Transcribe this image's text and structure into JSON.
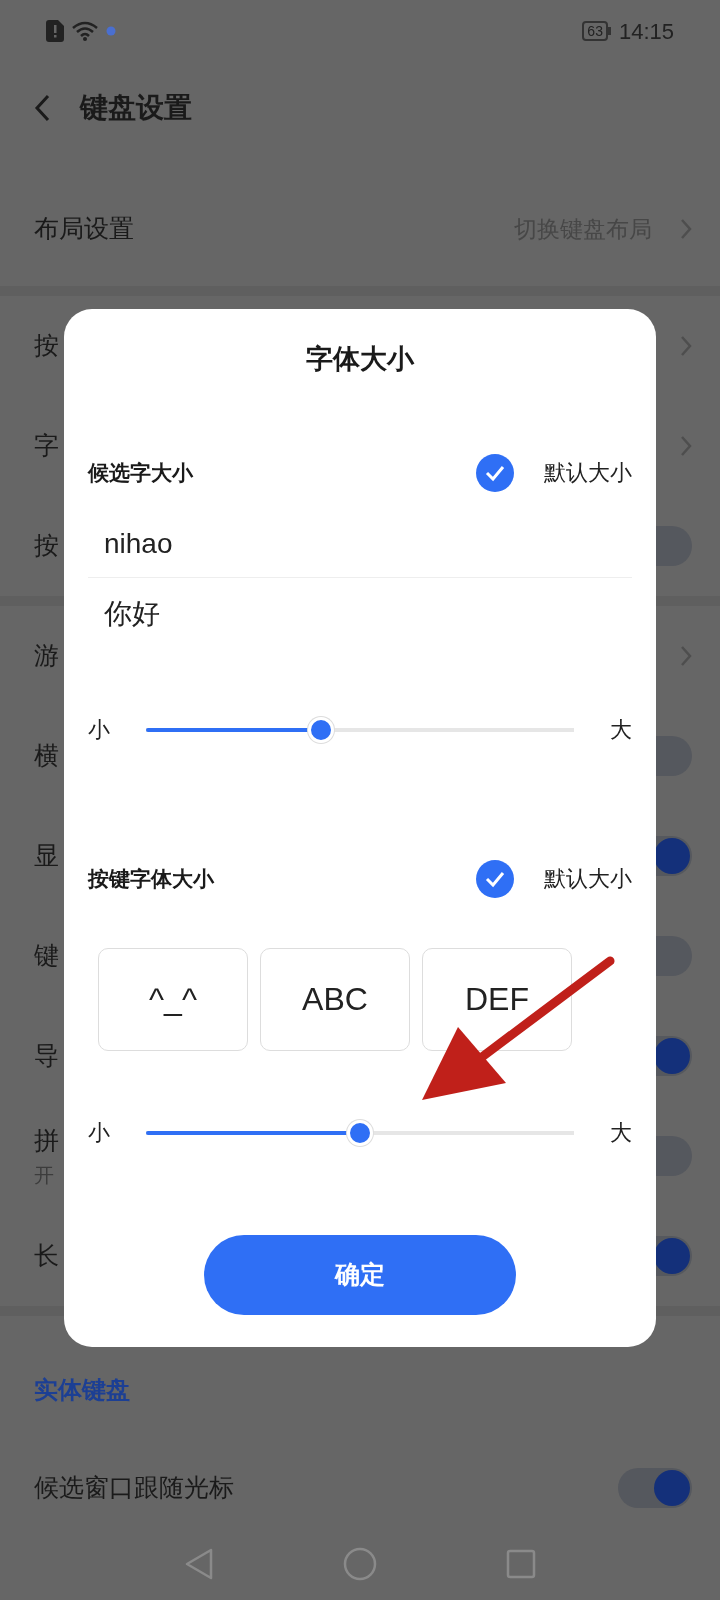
{
  "status_bar": {
    "battery": "63",
    "time": "14:15"
  },
  "header": {
    "title": "键盘设置"
  },
  "layout_row": {
    "label": "布局设置",
    "value": "切换键盘布局"
  },
  "sections": [
    {
      "rows": [
        {
          "kind": "chevron",
          "label": "按"
        },
        {
          "kind": "chevron",
          "label": "字"
        },
        {
          "kind": "toggle",
          "label": "按",
          "on": false
        }
      ]
    },
    {
      "rows": [
        {
          "kind": "chevron",
          "label": "游"
        },
        {
          "kind": "toggle",
          "label": "横",
          "on": false
        },
        {
          "kind": "toggle",
          "label": "显",
          "on": true
        },
        {
          "kind": "toggle",
          "label": "键",
          "on": false
        },
        {
          "kind": "toggle",
          "label": "导",
          "on": true
        },
        {
          "kind": "toggle",
          "label": "拼",
          "subtitle": "开",
          "on": false
        },
        {
          "kind": "toggle",
          "label": "长",
          "on": true
        }
      ]
    }
  ],
  "physical_section": {
    "title": "实体键盘",
    "rows": [
      {
        "kind": "toggle",
        "label": "候选窗口跟随光标",
        "on": true
      }
    ]
  },
  "dialog": {
    "title": "字体大小",
    "candidate": {
      "label": "候选字大小",
      "default_checked": true,
      "default_label": "默认大小",
      "preview": [
        "nihao",
        "你好"
      ],
      "min": "小",
      "max": "大",
      "level": 0.41
    },
    "keys": {
      "label": "按键字体大小",
      "default_checked": true,
      "default_label": "默认大小",
      "preview": [
        "^_^",
        "ABC",
        "DEF"
      ],
      "min": "小",
      "max": "大",
      "level": 0.5
    },
    "confirm": "确定"
  }
}
